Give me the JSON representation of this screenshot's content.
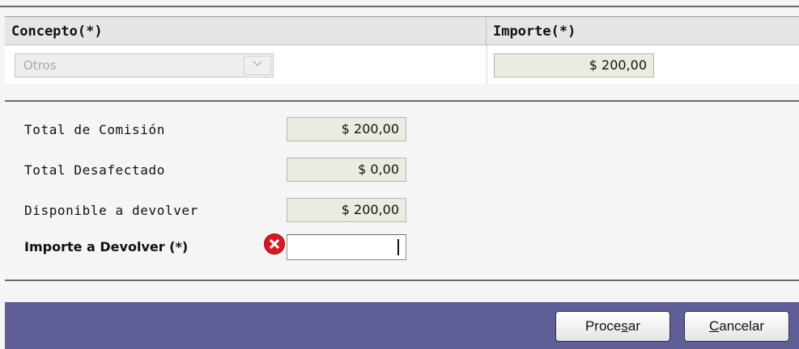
{
  "table": {
    "headers": {
      "concepto": "Concepto(*)",
      "importe": "Importe(*)"
    },
    "row": {
      "concepto_selected": "Otros",
      "importe_value": "$ 200,00"
    }
  },
  "summary": {
    "total_comision": {
      "label": "Total de Comisión",
      "value": "$ 200,00"
    },
    "total_desafectado": {
      "label": "Total Desafectado",
      "value": "$ 0,00"
    },
    "disponible": {
      "label": "Disponible a devolver",
      "value": "$ 200,00"
    },
    "importe_devolver": {
      "label": "Importe a Devolver (*)",
      "value": ""
    }
  },
  "buttons": {
    "procesar": {
      "pre": "Proce",
      "accel": "s",
      "post": "ar"
    },
    "cancelar": {
      "pre": "",
      "accel": "C",
      "post": "ancelar"
    }
  },
  "colors": {
    "footer": "#5f5e96",
    "error": "#d8181e",
    "readonly_field": "#ecebe2"
  },
  "icons": {
    "error": "error-x-icon",
    "dropdown": "chevron-down-icon"
  }
}
